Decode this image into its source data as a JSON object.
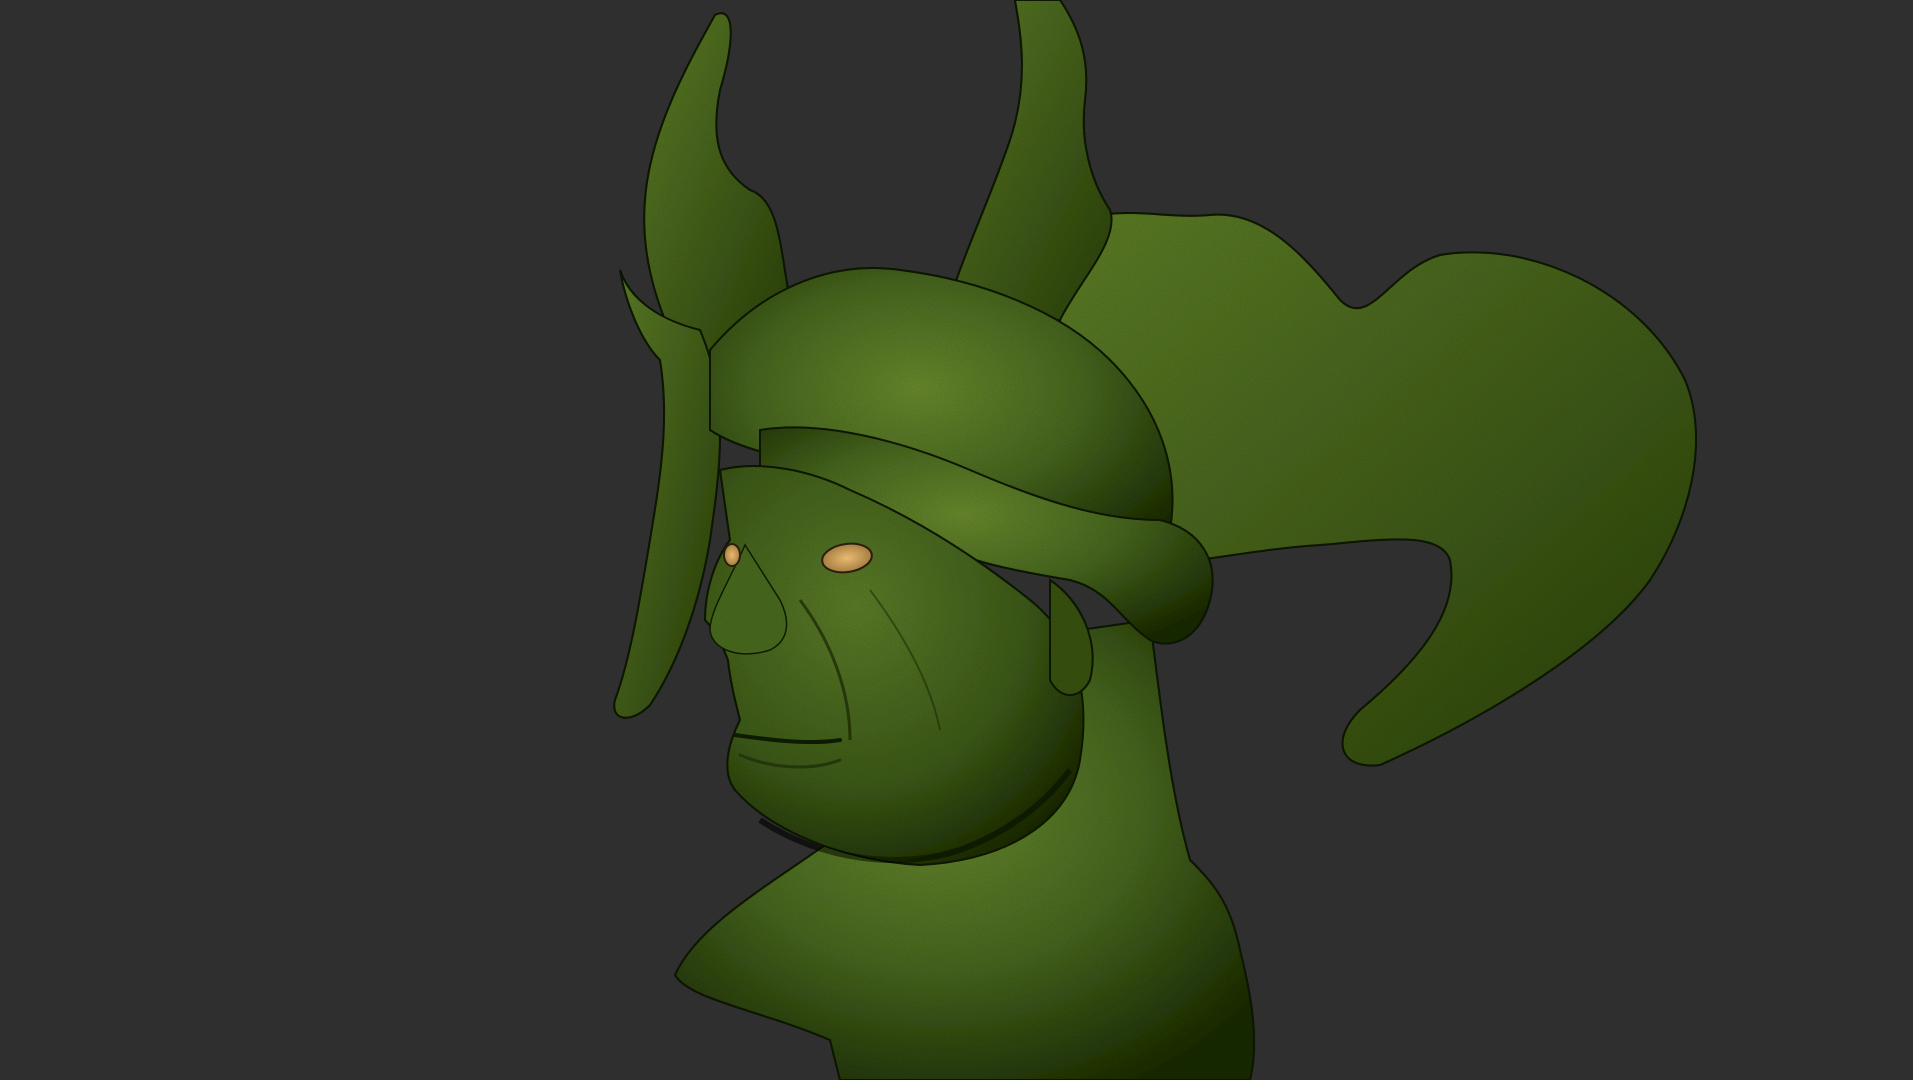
{
  "viewport": {
    "background_color": "#2f2f2f",
    "model_skin_color": "#3e5a1e",
    "model_highlight_color": "#6e8f32",
    "model_shadow_color": "#1c2a0c",
    "eye_color": "#d9a962"
  }
}
